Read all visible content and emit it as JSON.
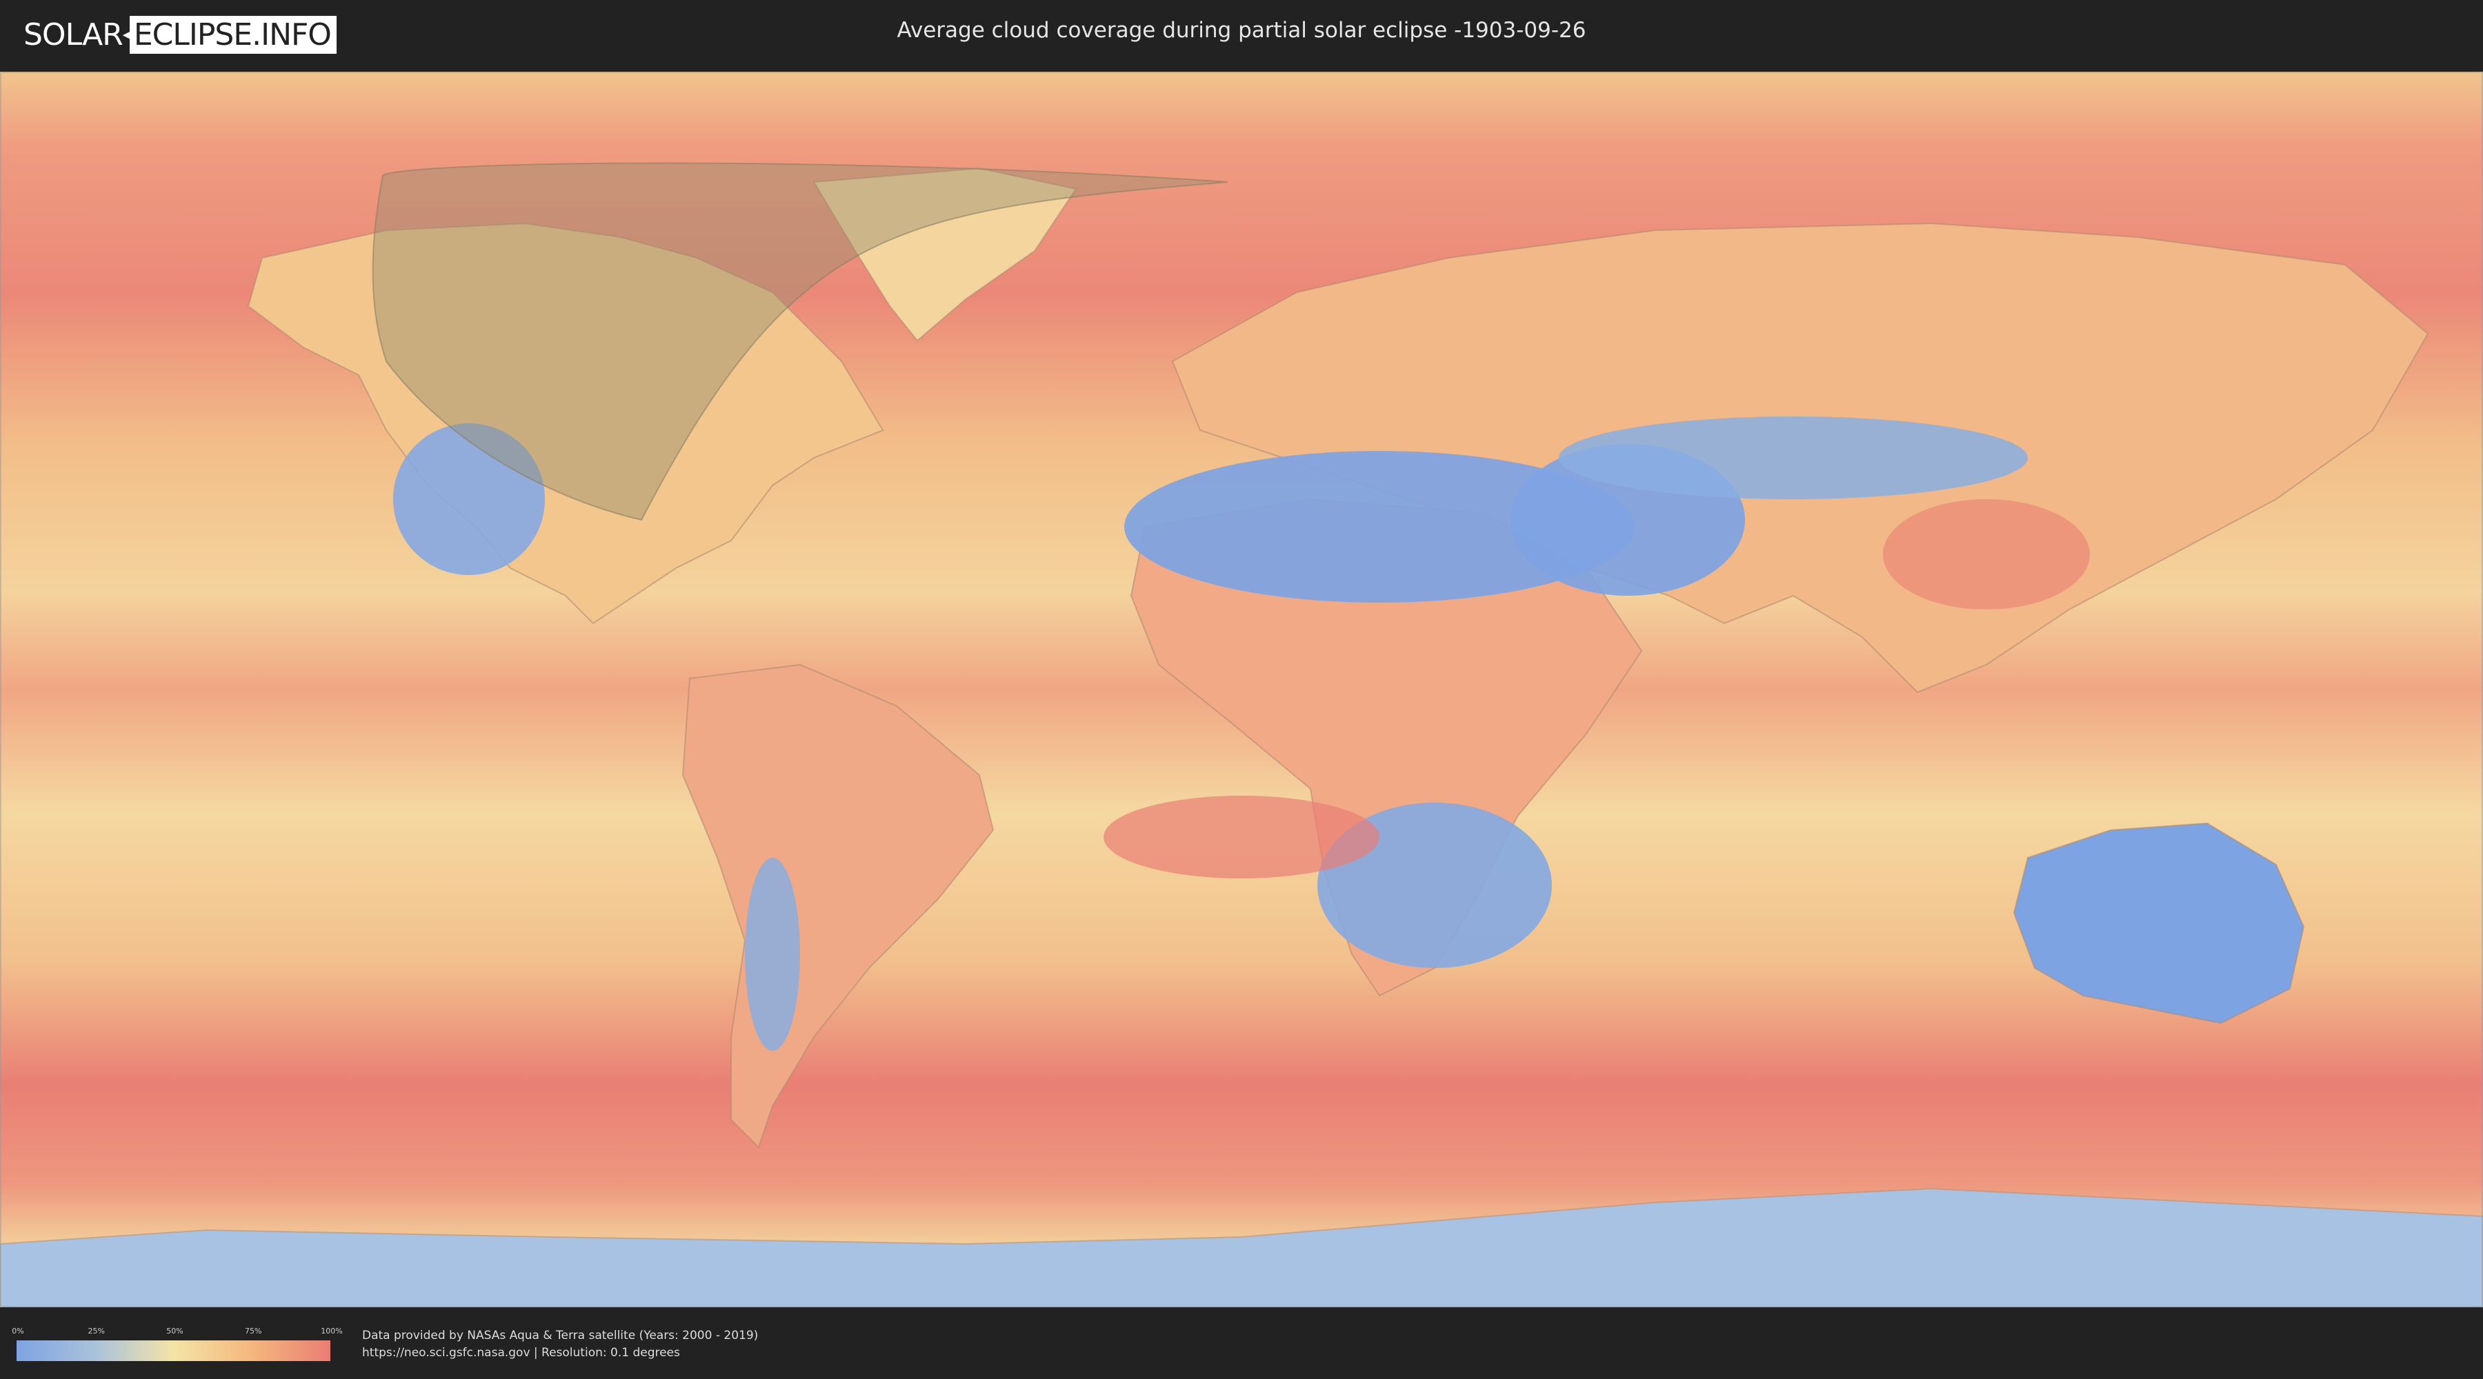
{
  "header": {
    "logo_part1": "SOLAR",
    "logo_part2": "ECLIPSE.INFO",
    "title": "Average cloud coverage during partial solar eclipse -1903-09-26"
  },
  "map": {
    "type": "cloud-coverage-world-map",
    "eclipse_region_color": "#9a8e6e",
    "palette": {
      "low": "#7ea3e3",
      "mid": "#f4e3a6",
      "high": "#ea7d74"
    }
  },
  "legend": {
    "ticks": [
      "0%",
      "25%",
      "50%",
      "75%",
      "100%"
    ]
  },
  "credits": {
    "line1": "Data provided by NASAs Aqua & Terra satellite (Years: 2000 - 2019)",
    "line2": "https://neo.sci.gsfc.nasa.gov | Resolution: 0.1 degrees"
  }
}
